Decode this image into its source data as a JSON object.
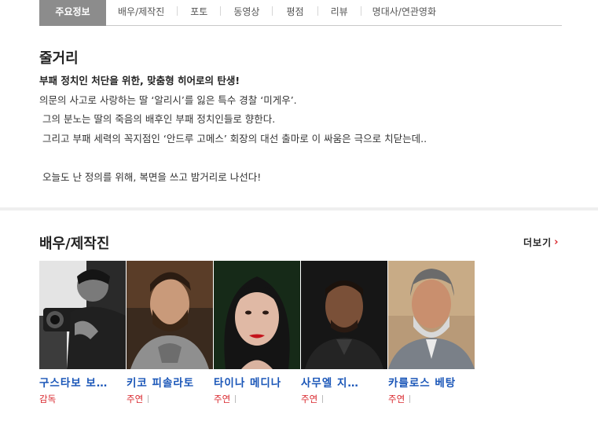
{
  "tabs": [
    {
      "label": "주요정보",
      "active": true
    },
    {
      "label": "배우/제작진"
    },
    {
      "label": "포토"
    },
    {
      "label": "동영상"
    },
    {
      "label": "평점"
    },
    {
      "label": "리뷰"
    },
    {
      "label": "명대사/연관영화"
    }
  ],
  "synopsis": {
    "title": "줄거리",
    "lines": [
      "부패 정치인 처단을 위한, 맞춤형 히어로의 탄생!",
      "의문의 사고로 사랑하는 딸 ‘알리시’를 잃은 특수 경찰 ‘미게우’.",
      " 그의 분노는 딸의 죽음의 배후인 부패 정치인들로 향한다.",
      " 그리고 부패 세력의 꼭지점인 ‘안드루 고메스’ 회장의 대선 출마로 이 싸움은 극으로 치닫는데..",
      "",
      " 오늘도 난 정의를 위해, 복면을 쓰고 밤거리로 나선다!"
    ]
  },
  "cast": {
    "title": "배우/제작진",
    "more_label": "더보기",
    "more_icon": "chevron-right-icon",
    "people": [
      {
        "name": "구스타보 보…",
        "role": "감독",
        "photo": "bw"
      },
      {
        "name": "키코 피솔라토",
        "role": "주연",
        "photo": "man1"
      },
      {
        "name": "타이나 메디나",
        "role": "주연",
        "photo": "woman"
      },
      {
        "name": "사무엘 지…",
        "role": "주연",
        "photo": "man2"
      },
      {
        "name": "카를로스 베탕",
        "role": "주연",
        "photo": "man3"
      }
    ]
  },
  "colors": {
    "accent_red": "#d9262c",
    "link_blue": "#1a56b8",
    "active_tab": "#8c8c8c"
  }
}
